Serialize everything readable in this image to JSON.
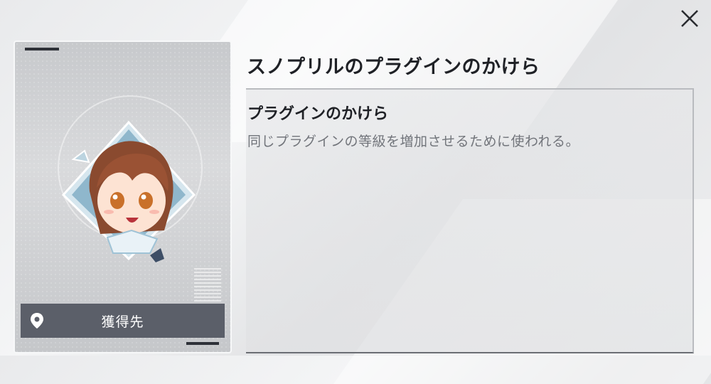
{
  "item": {
    "title": "スノプリルのプラグインのかけら",
    "name": "プラグインのかけら",
    "description": "同じプラグインの等級を増加させるために使われる。"
  },
  "card": {
    "acquire_label": "獲得先",
    "acquire_icon": "location-pin-icon",
    "art": "character-portrait"
  },
  "close_icon": "close-icon",
  "colors": {
    "text_dark": "#1f2126",
    "text_muted": "#72757b",
    "button_bg": "#5b5f69"
  }
}
